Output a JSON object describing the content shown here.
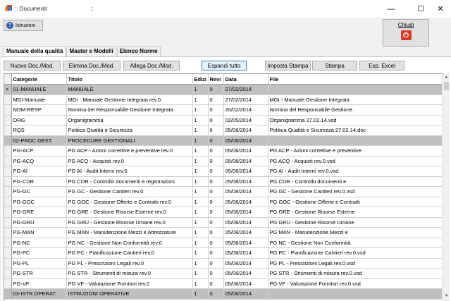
{
  "window": {
    "title": ":: Documenti:                           ::",
    "minimize": "—",
    "maximize": "☐",
    "close": "✕"
  },
  "toolbar": {
    "istruzioni_label": "Istruzioni",
    "chiudi_label": "Chiudi"
  },
  "tabs": [
    {
      "label": "Manuale della qualità",
      "active": true
    },
    {
      "label": "Master e Modelli",
      "active": false
    },
    {
      "label": "Elenco Norme",
      "active": false
    }
  ],
  "actions": {
    "nuovo": "Nuovo Doc./Mod.",
    "elimina": "Elimina Doc./Mod.",
    "allega": "Allega Doc./Mod.",
    "espandi": "Espandi tutto",
    "imposta_stampa": "Imposta Stampa",
    "stampa": "Stampa",
    "exp_excel": "Exp. Excel"
  },
  "grid": {
    "columns": [
      "Categorie",
      "Titolo",
      "Edizi",
      "Revi",
      "Data",
      "File"
    ],
    "rows": [
      {
        "group": true,
        "cat": "01-MANUALE",
        "titolo": "MANUALE",
        "ed": "1",
        "rev": "0",
        "data": "27/02/2014",
        "file": ""
      },
      {
        "group": false,
        "cat": "MGI-Manuale",
        "titolo": "MGI - Manuale Gestione Integrata rev.0",
        "ed": "1",
        "rev": "0",
        "data": "27/02/2014",
        "file": "MGI - Manuale Gestione Integrata"
      },
      {
        "group": false,
        "cat": "NOM-RESP",
        "titolo": "Nomina del Responsabile Gestione Integrata",
        "ed": "1",
        "rev": "0",
        "data": "20/02/2014",
        "file": "Nomina del Responsabile Gestione"
      },
      {
        "group": false,
        "cat": "ORG",
        "titolo": "Organigramma",
        "ed": "1",
        "rev": "0",
        "data": "02/05/2014",
        "file": "Organigramma 27.02.14.vsd"
      },
      {
        "group": false,
        "cat": "RQS",
        "titolo": "Politica Qualità e Sicurezza",
        "ed": "1",
        "rev": "0",
        "data": "05/08/2014",
        "file": "Politica Qualità e Sicurezza 27.02.14.doc"
      },
      {
        "group": true,
        "cat": "02-PROC.GEST.",
        "titolo": "PROCEDURE GESTIONALI",
        "ed": "1",
        "rev": "0",
        "data": "05/08/2014",
        "file": ""
      },
      {
        "group": false,
        "cat": "PG-ACP",
        "titolo": "PG ACP - Azioni correttive e preventive rev.0",
        "ed": "1",
        "rev": "0",
        "data": "05/08/2014",
        "file": "PG ACP - Azioni correttive e preventive"
      },
      {
        "group": false,
        "cat": "PG-ACQ",
        "titolo": "PG ACQ - Acquisti rev.0",
        "ed": "1",
        "rev": "0",
        "data": "05/08/2014",
        "file": "PG ACQ - Acquisti rev.0.vsd"
      },
      {
        "group": false,
        "cat": "PG-AI",
        "titolo": "PG AI - Audit Interni rev.0",
        "ed": "1",
        "rev": "0",
        "data": "05/08/2014",
        "file": "PG AI - Audit Interni rev.0.vsd"
      },
      {
        "group": false,
        "cat": "PG-CDR",
        "titolo": "PG CDR - Controllo documenti e registrazioni",
        "ed": "1",
        "rev": "0",
        "data": "05/08/2014",
        "file": "PG CDR - Controllo documenti e"
      },
      {
        "group": false,
        "cat": "PG-GC",
        "titolo": "PG GC - Gestione Cantieri rev.0",
        "ed": "1",
        "rev": "0",
        "data": "05/08/2014",
        "file": "PG GC - Gestione Cantieri rev.0.vsd"
      },
      {
        "group": false,
        "cat": "PG-GOC",
        "titolo": "PG GOC - Gestione Offerte e Contratti rev.0",
        "ed": "1",
        "rev": "0",
        "data": "05/08/2014",
        "file": "PG GOC - Gestione  Offerte e Contratti"
      },
      {
        "group": false,
        "cat": "PG-GRE",
        "titolo": "PG GRE - Gestione Risorse Esterne rev.0",
        "ed": "1",
        "rev": "0",
        "data": "05/08/2014",
        "file": "PG GRE - Gestione Risorse Esterne"
      },
      {
        "group": false,
        "cat": "PG-GRU",
        "titolo": "PG GRU - Gestione Risorse Umane rev.0",
        "ed": "1",
        "rev": "0",
        "data": "05/08/2014",
        "file": "PG GRU - Gestione Risorse Umane"
      },
      {
        "group": false,
        "cat": "PG-MAN",
        "titolo": "PG MAN - Manutenzione Mezzi e Attrezzature",
        "ed": "1",
        "rev": "0",
        "data": "05/08/2014",
        "file": "PG MAN - Manutenzione Mezzi e"
      },
      {
        "group": false,
        "cat": "PG-NC",
        "titolo": "PG NC - Gestione Non Conformità rev.0",
        "ed": "1",
        "rev": "0",
        "data": "05/08/2014",
        "file": "PG NC - Gestione Non Conformità"
      },
      {
        "group": false,
        "cat": "PG-PC",
        "titolo": "PG PC - Pianificazione Cantieri rev.0",
        "ed": "1",
        "rev": "0",
        "data": "05/08/2014",
        "file": "PG PC - Pianificazione Cantieri rev.0.vsd"
      },
      {
        "group": false,
        "cat": "PG-PL",
        "titolo": "PG PL - Prescrizioni Legali rev.0",
        "ed": "1",
        "rev": "0",
        "data": "05/08/2014",
        "file": "PG PL - Prescrizioni Legali rev.0.vsd"
      },
      {
        "group": false,
        "cat": "PG-STR",
        "titolo": "PG STR - Strumenti di misura rev.0",
        "ed": "1",
        "rev": "0",
        "data": "05/08/2014",
        "file": "PG STR - Strumenti di misura rev.0.vsd"
      },
      {
        "group": false,
        "cat": "PG-VF",
        "titolo": "PG VF - Valutazione Fornitori rev.0",
        "ed": "1",
        "rev": "0",
        "data": "05/08/2014",
        "file": "PG VF - Valutazione Fornitori rev.0.vsd"
      },
      {
        "group": true,
        "cat": "03-ISTR.OPERAT.",
        "titolo": "ISTRUZIONI OPERATIVE",
        "ed": "1",
        "rev": "0",
        "data": "05/08/2014",
        "file": ""
      }
    ]
  }
}
